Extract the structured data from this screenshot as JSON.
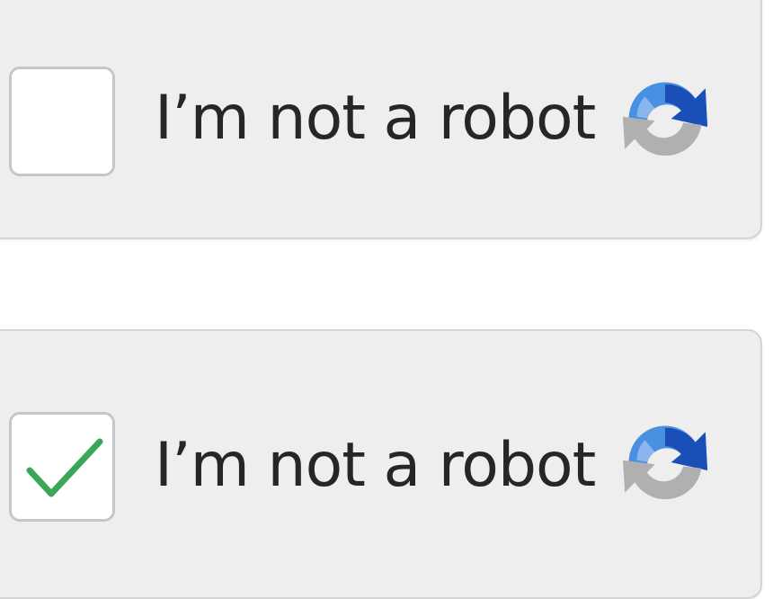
{
  "widgets": [
    {
      "state": "unchecked",
      "label": "I’m not a robot",
      "logo_icon": "recaptcha-logo-icon"
    },
    {
      "state": "checked",
      "label": "I’m not a robot",
      "logo_icon": "recaptcha-logo-icon",
      "check_icon": "checkmark-icon",
      "check_color": "#3aa757"
    }
  ],
  "colors": {
    "panel_background": "#eeeeee",
    "panel_border": "#d4d4d4",
    "checkbox_background": "#ffffff",
    "checkbox_border": "#c6c6c6",
    "label_text": "#262626",
    "logo_dark_blue": "#1a4fb8",
    "logo_light_blue": "#4a90e2",
    "logo_gray": "#b0b0b0"
  }
}
